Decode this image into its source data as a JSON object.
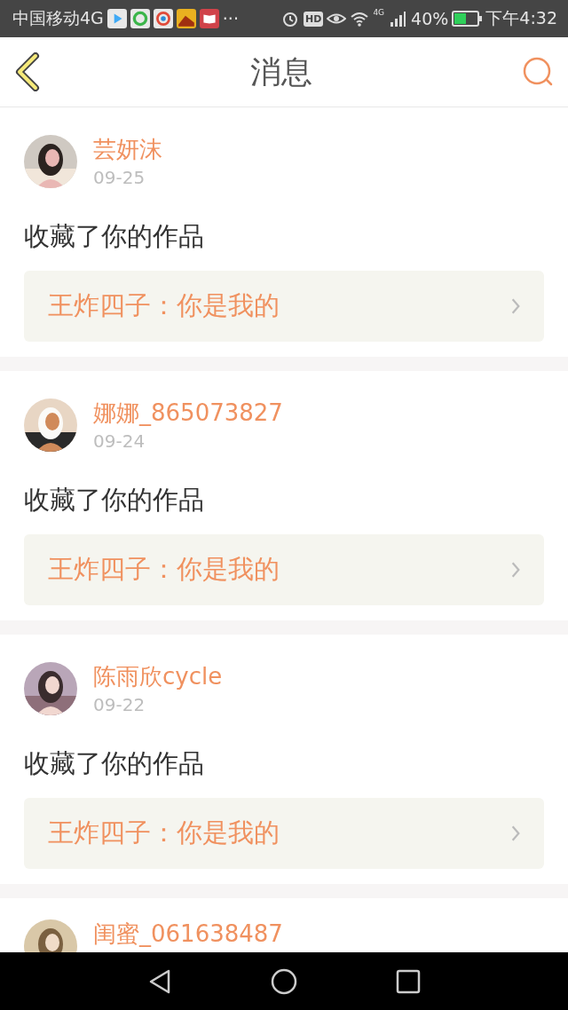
{
  "status_bar": {
    "carrier": "中国移动4G",
    "more": "···",
    "hd": "HD",
    "network": "4G",
    "battery": "40%",
    "time": "下午4:32"
  },
  "header": {
    "title": "消息"
  },
  "messages": [
    {
      "user": "芸妍沫",
      "date": "09-25",
      "action": "收藏了你的作品",
      "quote": "王炸四子：你是我的"
    },
    {
      "user": "娜娜_865073827",
      "date": "09-24",
      "action": "收藏了你的作品",
      "quote": "王炸四子：你是我的"
    },
    {
      "user": "陈雨欣cycle",
      "date": "09-22",
      "action": "收藏了你的作品",
      "quote": "王炸四子：你是我的"
    },
    {
      "user": "闺蜜_061638487"
    }
  ]
}
